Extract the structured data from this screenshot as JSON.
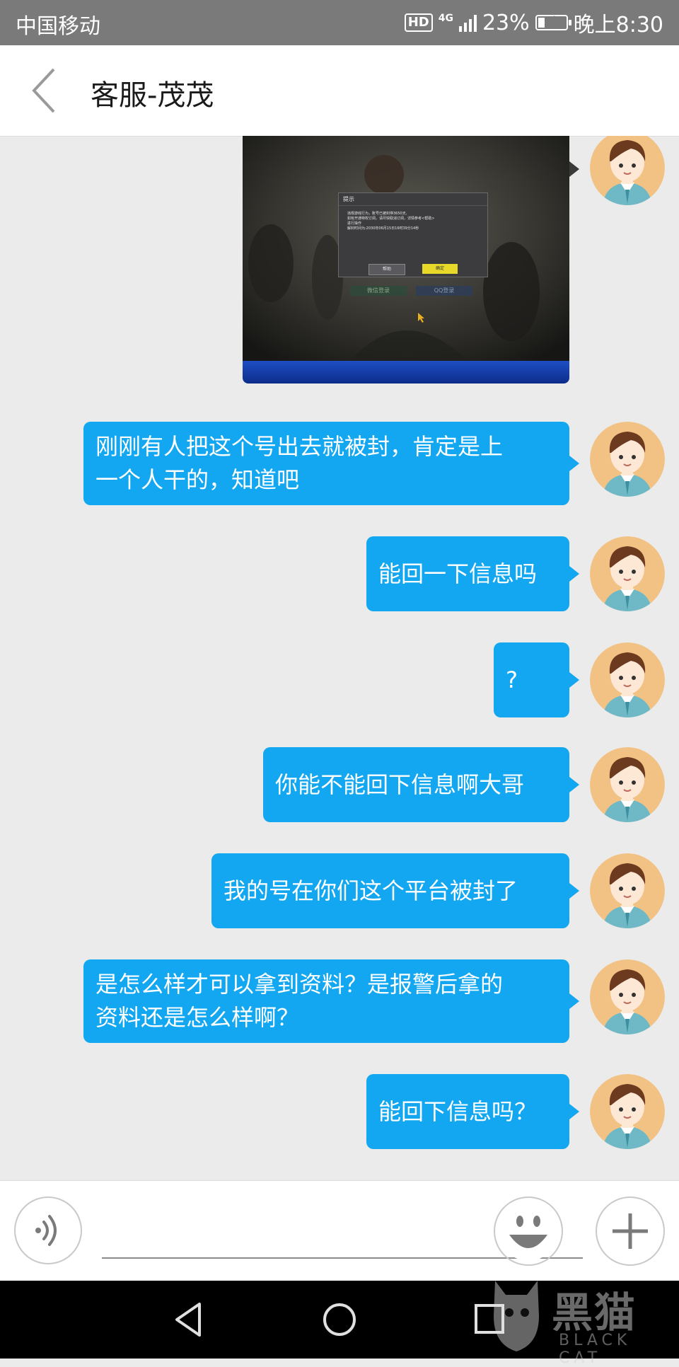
{
  "status_bar": {
    "carrier": "中国移动",
    "hd": "HD",
    "network": "4G",
    "battery": "23%",
    "battery_level": 0.23,
    "time": "晚上8:30"
  },
  "header": {
    "title": "客服-茂茂"
  },
  "messages": [
    {
      "type": "image",
      "content": "game-ban-notice-screenshot"
    },
    {
      "type": "text",
      "line1": "刚刚有人把这个号出去就被封，肯定是上",
      "line2": "一个人干的，知道吧"
    },
    {
      "type": "text",
      "line1": "能回一下信息吗"
    },
    {
      "type": "text",
      "line1": "?"
    },
    {
      "type": "text",
      "line1": "你能不能回下信息啊大哥"
    },
    {
      "type": "text",
      "line1": "我的号在你们这个平台被封了"
    },
    {
      "type": "text",
      "line1": "是怎么样才可以拿到资料？是报警后拿的",
      "line2": "资料还是怎么样啊？"
    },
    {
      "type": "text",
      "line1": "能回下信息吗？"
    }
  ],
  "game_dialog": {
    "title": "提示",
    "line1": "违规游戏行为，账号已被封停3650天,",
    "line2": "如有开通特权订阅，请尽快取消订阅，详情参考<帮助>",
    "line3": "进行操作",
    "line4": "解封时间为:2030年06月15日16时39分14秒",
    "help_button": "帮助",
    "ok_button": "确定",
    "wechat_login": "微信登录",
    "qq_login": "QQ登录"
  },
  "input_bar": {
    "placeholder": ""
  },
  "watermark": {
    "text": "黑猫",
    "sub": "BLACK CAT"
  },
  "icons": {
    "back": "chevron-left-icon",
    "voice": "voice-icon",
    "emoji": "smiley-icon",
    "add": "plus-icon"
  },
  "colors": {
    "bubble": "#12a7f0",
    "status_bar": "#7a7a7a",
    "background": "#ebebeb",
    "avatar_bg": "#f2c284"
  }
}
